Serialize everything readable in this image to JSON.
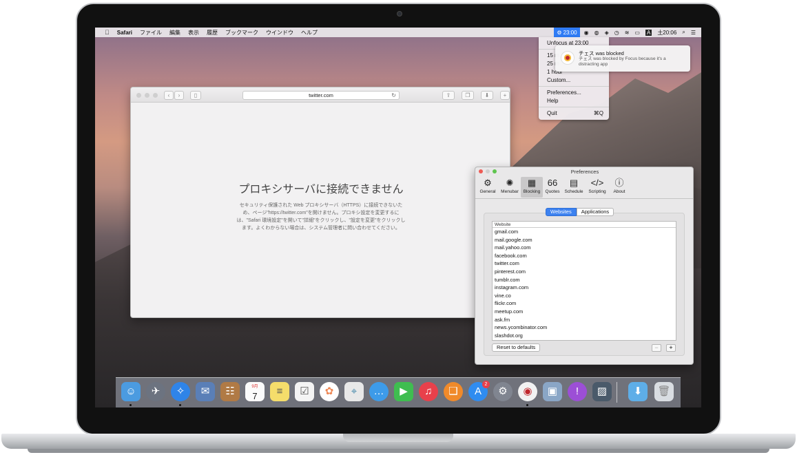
{
  "menubar": {
    "apple": "",
    "app": "Safari",
    "items": [
      "ファイル",
      "編集",
      "表示",
      "履歴",
      "ブックマーク",
      "ウインドウ",
      "ヘルプ"
    ],
    "focus_time": "23:00",
    "clock": "土20:06"
  },
  "focus_menu": {
    "unfocus": "Unfocus at 23:00",
    "d15": "15 m",
    "d25": "25 m",
    "d1h": "1 hour",
    "custom": "Custom...",
    "preferences": "Preferences...",
    "help": "Help",
    "quit": "Quit",
    "quit_shortcut": "⌘Q"
  },
  "notification": {
    "title": "チェス was blocked",
    "body": "チェス was blocked by Focus because it's a distracting app"
  },
  "safari": {
    "url": "twitter.com",
    "error_title": "プロキシサーバに接続できません",
    "error_body": "セキュリティ保護された Web プロキシサーバ（HTTPS）に接続できないため、ページ\"https://twitter.com\"を開けません。プロキシ設定を変更するには、\"Safari 環境設定\"を開いて\"詳細\"をクリックし、\"設定を変更\"をクリックします。よくわからない場合は、システム管理者に問い合わせてください。"
  },
  "preferences": {
    "title": "Preferences",
    "tabs": [
      {
        "label": "General",
        "icon": "gear-icon"
      },
      {
        "label": "Menubar",
        "icon": "aperture-icon"
      },
      {
        "label": "Blocking",
        "icon": "window-icon"
      },
      {
        "label": "Quotes",
        "icon": "quote-icon"
      },
      {
        "label": "Schedule",
        "icon": "calendar-icon"
      },
      {
        "label": "Scripting",
        "icon": "code-icon"
      },
      {
        "label": "About",
        "icon": "info-icon"
      }
    ],
    "selected_tab": "Blocking",
    "segment": {
      "websites": "Websites",
      "applications": "Applications"
    },
    "column_header": "Website",
    "sites": [
      "gmail.com",
      "mail.google.com",
      "mail.yahoo.com",
      "facebook.com",
      "twitter.com",
      "pinterest.com",
      "tumblr.com",
      "instagram.com",
      "vine.co",
      "flickr.com",
      "meetup.com",
      "ask.fm",
      "news.ycombinator.com",
      "slashdot.org"
    ],
    "reset_label": "Reset to defaults",
    "remove_label": "−",
    "add_label": "+"
  },
  "dock": {
    "calendar_month": "9月",
    "calendar_day": "7",
    "appstore_badge": "2"
  },
  "colors": {
    "accent": "#3d82f0",
    "focus_blue": "#2f7bf5"
  }
}
